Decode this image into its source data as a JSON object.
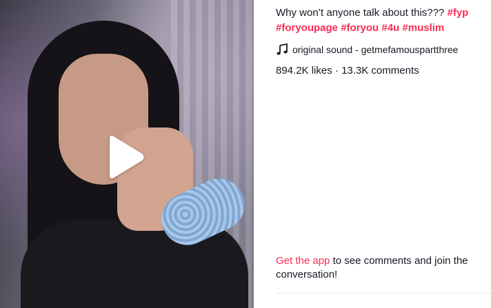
{
  "post": {
    "description": "Why won’t anyone talk about this??? ",
    "hashtags": [
      "#fyp",
      "#foryoupage",
      "#foryou",
      "#4u",
      "#muslim"
    ],
    "music_label": "original sound - getmefamouspartthree",
    "likes": "894.2K likes",
    "separator": "·",
    "comments": "13.3K comments"
  },
  "cta": {
    "link_label": "Get the app",
    "text": " to see comments and join the conversation!"
  },
  "icons": {
    "play": "play-icon",
    "music": "music-note-icon"
  },
  "colors": {
    "accent": "#fe2c55",
    "text": "#161823"
  }
}
